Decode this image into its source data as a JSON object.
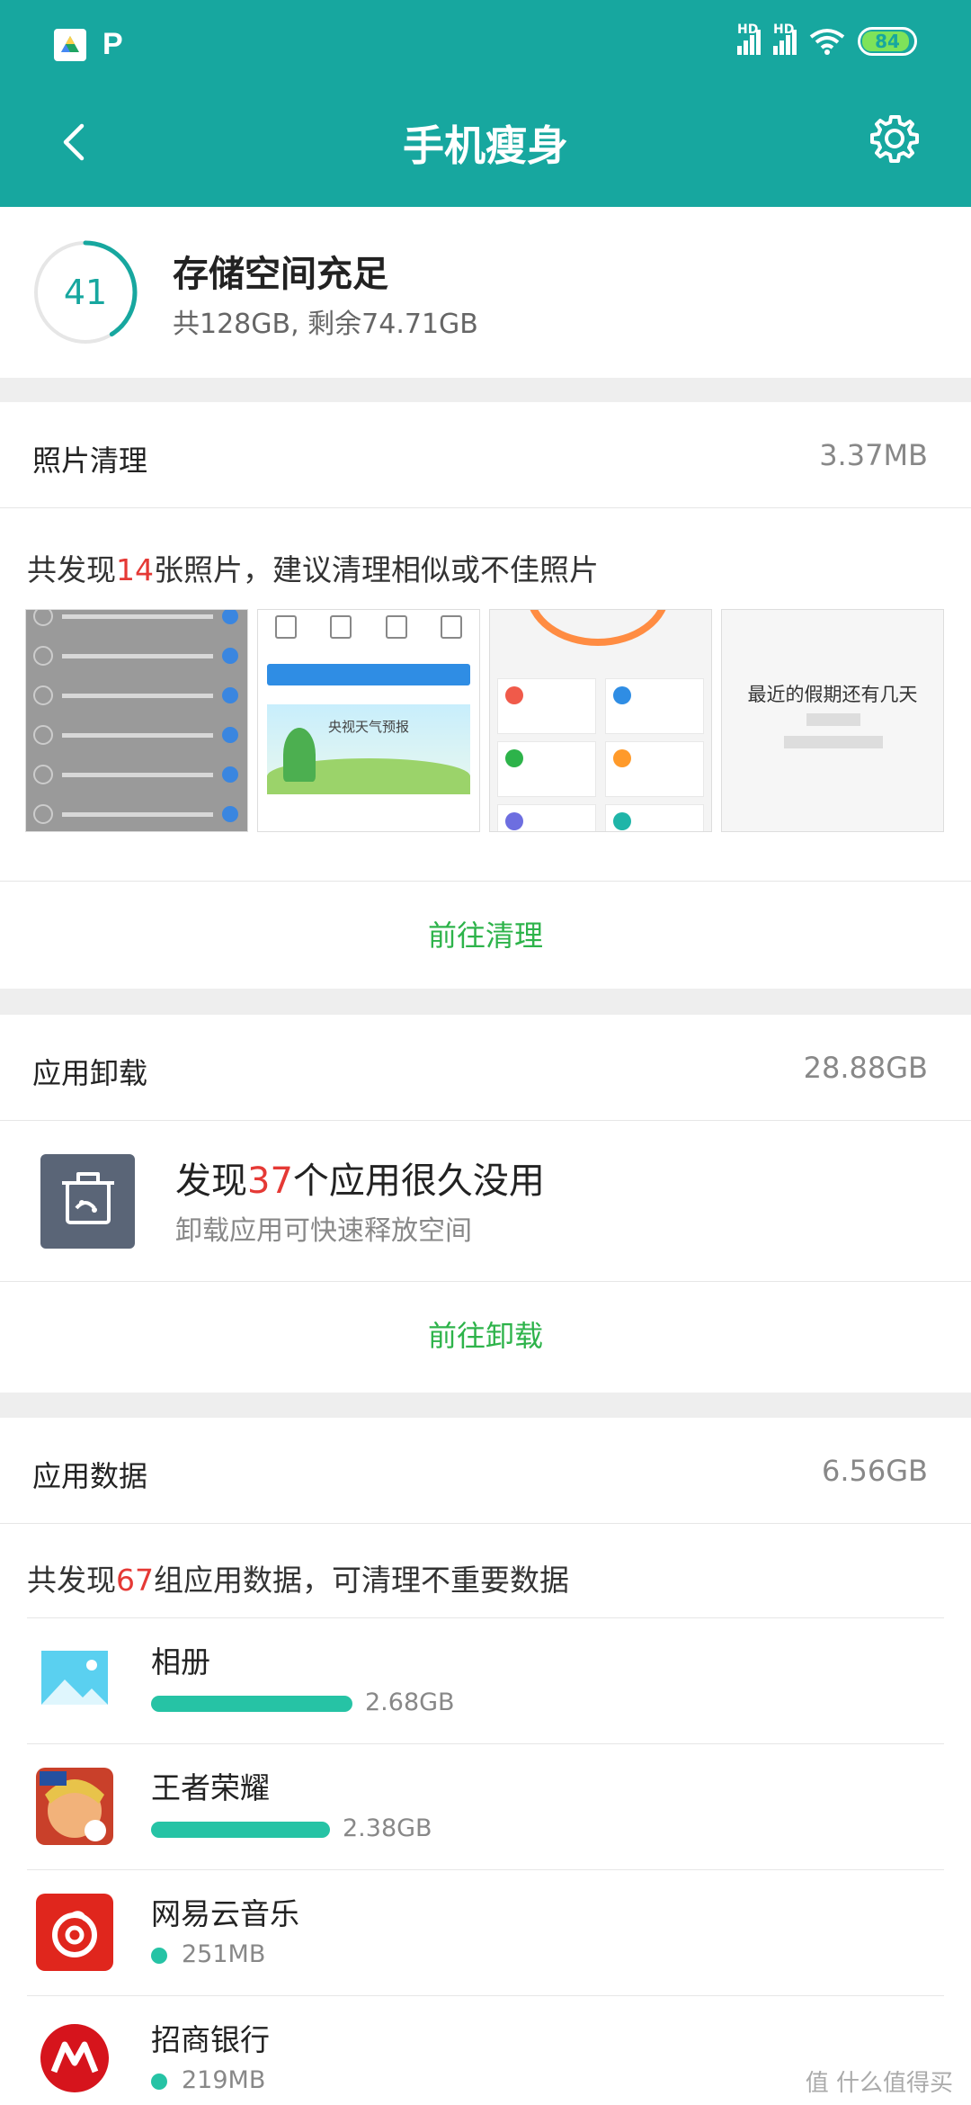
{
  "status_bar": {
    "app_icon_2": "P",
    "hd_label": "HD",
    "battery": "84"
  },
  "header": {
    "title": "手机瘦身",
    "back_icon": "chevron-left-icon",
    "settings_icon": "gear-icon"
  },
  "storage": {
    "score": "41",
    "score_fraction": 0.41,
    "title": "存储空间充足",
    "subtitle": "共128GB, 剩余74.71GB"
  },
  "photos": {
    "label": "照片清理",
    "size": "3.37MB",
    "desc_prefix": "共发现",
    "desc_count": "14",
    "desc_suffix": "张照片，建议清理相似或不佳照片",
    "thumb2_caption": "央视天气预报",
    "thumb4_text": "最近的假期还有几天",
    "action": "前往清理"
  },
  "uninstall": {
    "label": "应用卸载",
    "size": "28.88GB",
    "title_prefix": "发现",
    "title_count": "37",
    "title_suffix": "个应用很久没用",
    "subtitle": "卸载应用可快速释放空间",
    "action": "前往卸载"
  },
  "app_data": {
    "label": "应用数据",
    "size": "6.56GB",
    "desc_prefix": "共发现",
    "desc_count": "67",
    "desc_suffix": "组应用数据，可清理不重要数据",
    "apps": [
      {
        "name": "相册",
        "size": "2.68GB",
        "fraction": 1.0
      },
      {
        "name": "王者荣耀",
        "size": "2.38GB",
        "fraction": 0.89
      },
      {
        "name": "网易云音乐",
        "size": "251MB",
        "fraction": 0.0
      },
      {
        "name": "招商银行",
        "size": "219MB",
        "fraction": 0.0
      }
    ]
  },
  "watermark": "值 什么值得买"
}
